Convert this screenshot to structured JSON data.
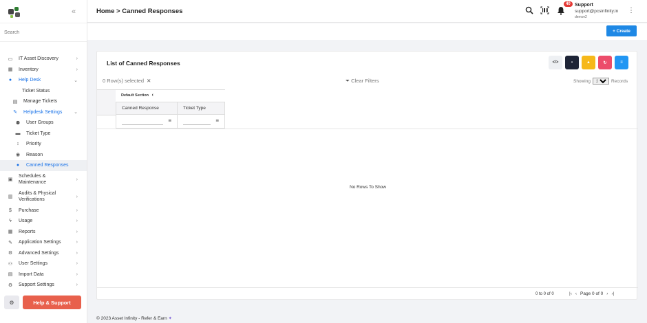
{
  "sidebar": {
    "search_placeholder": "Search",
    "items": [
      {
        "label": "IT Asset Discovery",
        "icon": "monitor-icon"
      },
      {
        "label": "Inventory",
        "icon": "inventory-icon"
      },
      {
        "label": "Help Desk",
        "icon": "help-icon"
      },
      {
        "label": "Ticket Status",
        "icon": ""
      },
      {
        "label": "Manage Tickets",
        "icon": "tickets-icon"
      },
      {
        "label": "Helpdesk Settings",
        "icon": "wrench-icon"
      },
      {
        "label": "User Groups",
        "icon": "users-icon"
      },
      {
        "label": "Ticket Type",
        "icon": "ticket-type-icon"
      },
      {
        "label": "Priority",
        "icon": "priority-icon"
      },
      {
        "label": "Reason",
        "icon": "reason-icon"
      },
      {
        "label": "Canned Responses",
        "icon": "chat-icon"
      },
      {
        "label": "Schedules & Maintenance",
        "icon": "calendar-icon"
      },
      {
        "label": "Audits & Physical Verifications",
        "icon": "audit-icon"
      },
      {
        "label": "Purchase",
        "icon": "dollar-icon"
      },
      {
        "label": "Usage",
        "icon": "usage-icon"
      },
      {
        "label": "Reports",
        "icon": "reports-icon"
      },
      {
        "label": "Application Settings",
        "icon": "wrench-icon"
      },
      {
        "label": "Advanced Settings",
        "icon": "gears-icon"
      },
      {
        "label": "User Settings",
        "icon": "user-settings-icon"
      },
      {
        "label": "Import Data",
        "icon": "import-icon"
      },
      {
        "label": "Support Settings",
        "icon": "support-settings-icon"
      }
    ],
    "help_button": "Help & Support"
  },
  "header": {
    "breadcrumb": "Home > Canned Responses",
    "notification_count": "40",
    "user_name": "Support",
    "user_email": "support@pcsinfinity.in",
    "user_org": "demov2"
  },
  "actions": {
    "create_label": "+ Create"
  },
  "card": {
    "title": "List of Canned Responses",
    "rows_selected": "0  Row(s) selected",
    "clear_filters": "Clear Filters",
    "showing_label": "Showing",
    "page_size": "100",
    "records_label": "Records",
    "section_header": "Default Section",
    "columns": [
      "Canned Response",
      "Ticket Type"
    ],
    "no_rows": "No Rows To Show",
    "pagination_info": "0 to 0 of 0",
    "page_label": "Page 0 of 0"
  },
  "footer": {
    "copyright": "© 2023  Asset Infinity - Refer & Earn"
  },
  "colors": {
    "primary": "#1e88e5",
    "help_button": "#e8604c",
    "tb_dark": "#1f2537",
    "tb_yellow": "#f6b81a",
    "tb_red": "#ec4c6a",
    "tb_blue": "#2196f3"
  }
}
